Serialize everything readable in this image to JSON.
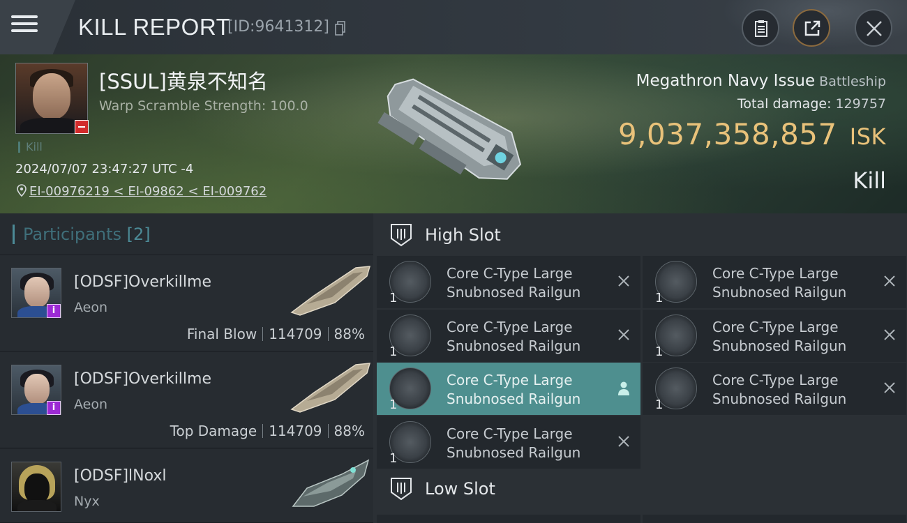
{
  "header": {
    "title": "KILL REPORT",
    "report_id": "[ID:9641312]",
    "icons": [
      "menu-icon",
      "copy-icon",
      "notes-icon",
      "share-icon",
      "close-icon"
    ]
  },
  "victim": {
    "name": "[SSUL]黄泉不知名",
    "warp_scramble": "Warp Scramble Strength: 100.0",
    "status_tag": "Kill",
    "timestamp": "2024/07/07 23:47:27 UTC -4",
    "location": "EI-00976219 < EI-09862 < EI-009762",
    "ship_name": "Megathron Navy Issue",
    "ship_class": "Battleship",
    "total_damage_label": "Total damage:",
    "total_damage": "129757",
    "isk_value": "9,037,358,857",
    "isk_unit": "ISK",
    "result": "Kill"
  },
  "participants": {
    "title": "Participants",
    "count": "[2]",
    "rows": [
      {
        "name": "[ODSF]Overkillme",
        "ship": "Aeon",
        "role": "Final Blow",
        "damage": "114709",
        "percent": "88%"
      },
      {
        "name": "[ODSF]Overkillme",
        "ship": "Aeon",
        "role": "Top Damage",
        "damage": "114709",
        "percent": "88%"
      },
      {
        "name": "[ODSF]lNoxl",
        "ship": "Nyx"
      }
    ]
  },
  "fitting": {
    "high_slot_title": "High Slot",
    "low_slot_title": "Low Slot",
    "modules": [
      {
        "qty": "1",
        "line1": "Core C-Type Large",
        "line2": "Snubnosed Railgun",
        "state": "destroyed"
      },
      {
        "qty": "1",
        "line1": "Core C-Type Large",
        "line2": "Snubnosed Railgun",
        "state": "destroyed"
      },
      {
        "qty": "1",
        "line1": "Core C-Type Large",
        "line2": "Snubnosed Railgun",
        "state": "destroyed"
      },
      {
        "qty": "1",
        "line1": "Core C-Type Large",
        "line2": "Snubnosed Railgun",
        "state": "destroyed"
      },
      {
        "qty": "1",
        "line1": "Core C-Type Large",
        "line2": "Snubnosed Railgun",
        "state": "dropped"
      },
      {
        "qty": "1",
        "line1": "Core C-Type Large",
        "line2": "Snubnosed Railgun",
        "state": "destroyed"
      },
      {
        "qty": "1",
        "line1": "Core C-Type Large",
        "line2": "Snubnosed Railgun",
        "state": "destroyed"
      }
    ]
  },
  "colors": {
    "isk_gold": "#e9c27a",
    "active_module": "#4e8f8f",
    "accent_teal": "#4c8a96",
    "loss_red": "#d22b2b",
    "info_purple": "#9c2ad4"
  }
}
